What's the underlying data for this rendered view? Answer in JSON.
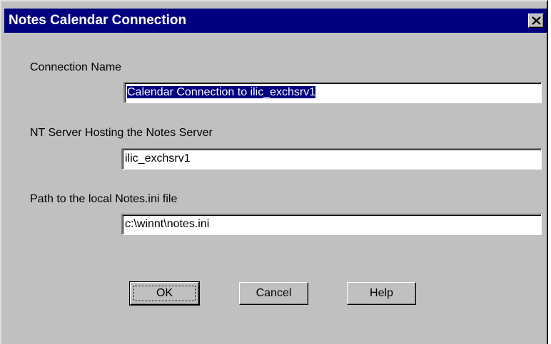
{
  "window": {
    "title": "Notes Calendar Connection",
    "close_icon": "close-icon"
  },
  "form": {
    "connection_name_label": "Connection Name",
    "connection_name_value": "Calendar Connection to ilic_exchsrv1",
    "nt_server_label": "NT Server Hosting the Notes Server",
    "nt_server_value": "ilic_exchsrv1",
    "notes_ini_label": "Path to the local Notes.ini file",
    "notes_ini_value": "c:\\winnt\\notes.ini"
  },
  "buttons": {
    "ok": "OK",
    "cancel": "Cancel",
    "help": "Help"
  },
  "colors": {
    "titlebar": "#000080",
    "dialog_face": "#c0c0c0",
    "selection": "#000080"
  }
}
